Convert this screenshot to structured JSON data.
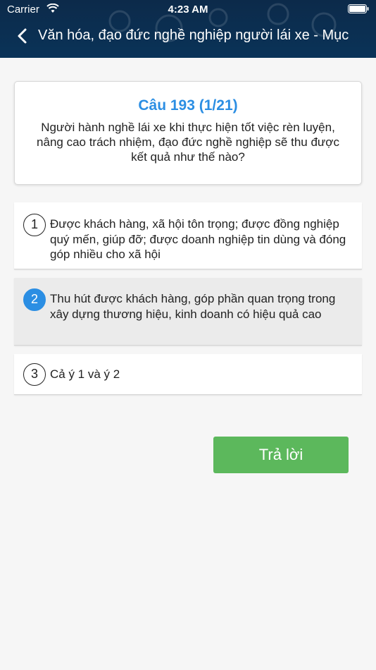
{
  "status_bar": {
    "carrier": "Carrier",
    "time": "4:23 AM"
  },
  "nav": {
    "back_icon": "chevron-left-icon",
    "title": "Văn hóa, đạo đức nghề nghiệp người lái xe - Mục"
  },
  "question": {
    "title": "Câu 193 (1/21)",
    "text": "Người hành nghề lái xe khi thực hiện tốt việc rèn luyện, nâng cao trách nhiệm, đạo đức nghề nghiệp sẽ thu được kết quả như thế nào?"
  },
  "answers": [
    {
      "number": "1",
      "text": "Được khách hàng, xã hội tôn trọng; được đồng nghiệp quý mến, giúp đỡ; được doanh nghiệp tin dùng và đóng góp nhiều cho xã hội",
      "selected": false
    },
    {
      "number": "2",
      "text": "Thu hút được khách hàng, góp phần quan trọng trong xây dựng thương hiệu, kinh doanh có hiệu quả cao",
      "selected": true
    },
    {
      "number": "3",
      "text": "Cả ý 1 và ý 2",
      "selected": false
    }
  ],
  "submit_label": "Trả lời",
  "colors": {
    "header_bg": "#0c2a4a",
    "accent_blue": "#2b8ee3",
    "submit_green": "#5cb85c",
    "selected_bg": "#ebebeb"
  }
}
